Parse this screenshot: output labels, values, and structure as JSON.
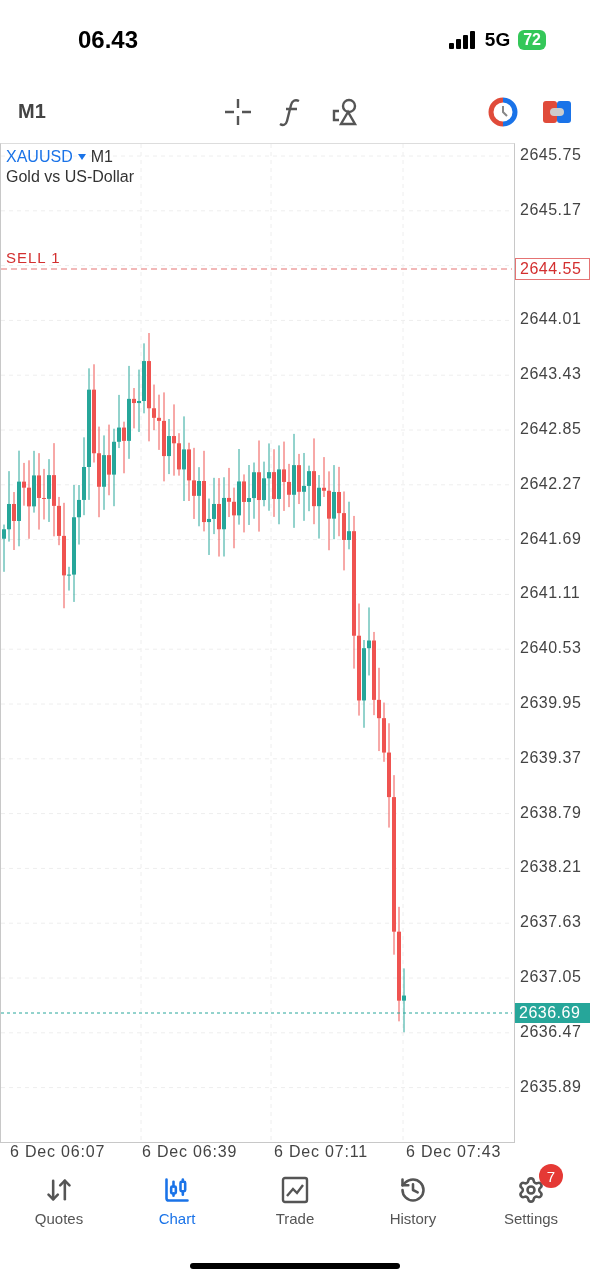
{
  "status_bar": {
    "time": "06.43",
    "network": "5G",
    "battery": "72"
  },
  "toolbar": {
    "timeframe": "M1"
  },
  "chart": {
    "symbol": "XAUUSD",
    "timeframe": "M1",
    "description": "Gold vs US-Dollar",
    "order_line": {
      "label": "SELL 1",
      "price": "2644.55"
    },
    "current_price": "2636.69",
    "price_axis": [
      "2645.75",
      "2645.17",
      "2644.01",
      "2643.43",
      "2642.85",
      "2642.27",
      "2641.69",
      "2641.11",
      "2640.53",
      "2639.95",
      "2639.37",
      "2638.79",
      "2638.21",
      "2637.63",
      "2637.05",
      "2636.47",
      "2635.89"
    ],
    "time_axis": [
      "6 Dec 06:07",
      "6 Dec 06:39",
      "6 Dec 07:11",
      "6 Dec 07:43"
    ]
  },
  "nav": [
    {
      "label": "Quotes",
      "selected": false
    },
    {
      "label": "Chart",
      "selected": true
    },
    {
      "label": "Trade",
      "selected": false
    },
    {
      "label": "History",
      "selected": false
    },
    {
      "label": "Settings",
      "selected": false,
      "badge": "7"
    }
  ]
}
